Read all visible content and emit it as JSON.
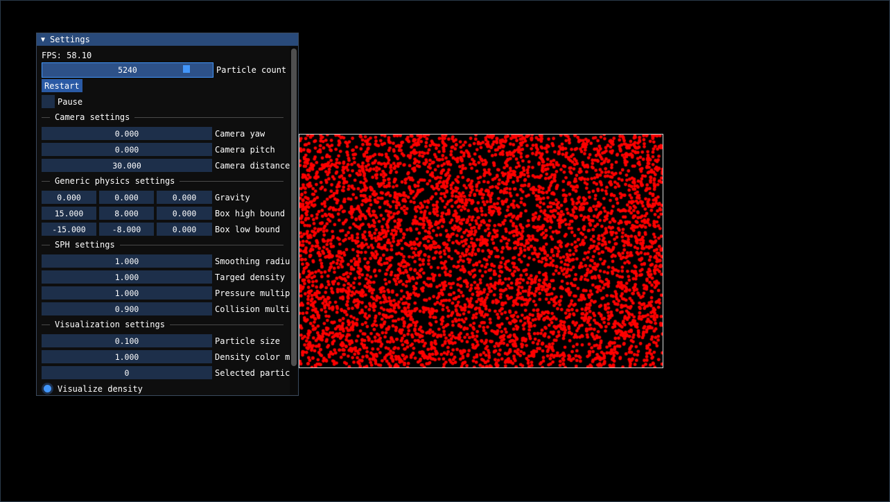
{
  "window": {
    "title": "Settings"
  },
  "fps": "FPS: 58.10",
  "particle_count": {
    "value": "5240",
    "label": "Particle count"
  },
  "restart_label": "Restart",
  "pause_label": "Pause",
  "camera": {
    "header": "Camera settings",
    "yaw": {
      "value": "0.000",
      "label": "Camera yaw"
    },
    "pitch": {
      "value": "0.000",
      "label": "Camera pitch"
    },
    "distance": {
      "value": "30.000",
      "label": "Camera distance"
    }
  },
  "physics": {
    "header": "Generic physics settings",
    "gravity": {
      "values": [
        "0.000",
        "0.000",
        "0.000"
      ],
      "label": "Gravity"
    },
    "box_high": {
      "values": [
        "15.000",
        "8.000",
        "0.000"
      ],
      "label": "Box high bound"
    },
    "box_low": {
      "values": [
        "-15.000",
        "-8.000",
        "0.000"
      ],
      "label": "Box low bound"
    }
  },
  "sph": {
    "header": "SPH settings",
    "smoothing": {
      "value": "1.000",
      "label": "Smoothing radiu"
    },
    "density": {
      "value": "1.000",
      "label": "Targed density"
    },
    "pressure": {
      "value": "1.000",
      "label": "Pressure multip"
    },
    "collision": {
      "value": "0.900",
      "label": "Collision multi"
    }
  },
  "viz": {
    "header": "Visualization settings",
    "particle_size": {
      "value": "0.100",
      "label": "Particle size"
    },
    "density_color": {
      "value": "1.000",
      "label": "Density color m"
    },
    "selected": {
      "value": "0",
      "label": "Selected partic"
    },
    "visualize_label": "Visualize density"
  },
  "simulation": {
    "particle_color": "#ff0000",
    "background": "#000000",
    "particle_count": 5240
  },
  "colors": {
    "accent": "#4296fa",
    "frame_bg": "#1d2f4a",
    "title_bg": "#294a7a"
  }
}
